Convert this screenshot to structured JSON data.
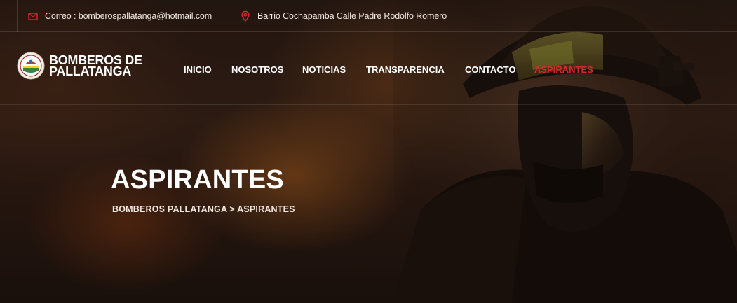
{
  "topbar": {
    "email_text": "Correo : bomberospallatanga@hotmail.com",
    "address_text": "Barrio Cochapamba Calle Padre Rodolfo Romero",
    "email_icon": "envelope-icon",
    "address_icon": "location-pin-icon"
  },
  "logo": {
    "line1": "BOMBEROS DE",
    "line2": "PALLATANGA"
  },
  "nav": {
    "items": [
      {
        "label": "INICIO"
      },
      {
        "label": "NOSOTROS"
      },
      {
        "label": "NOTICIAS"
      },
      {
        "label": "TRANSPARENCIA"
      },
      {
        "label": "CONTACTO"
      },
      {
        "label": "ASPIRANTES",
        "active": true
      }
    ]
  },
  "hero": {
    "title": "ASPIRANTES",
    "breadcrumb": "BOMBEROS PALLATANGA > ASPIRANTES"
  },
  "colors": {
    "accent": "#d32b2b",
    "text": "#ffffff"
  }
}
